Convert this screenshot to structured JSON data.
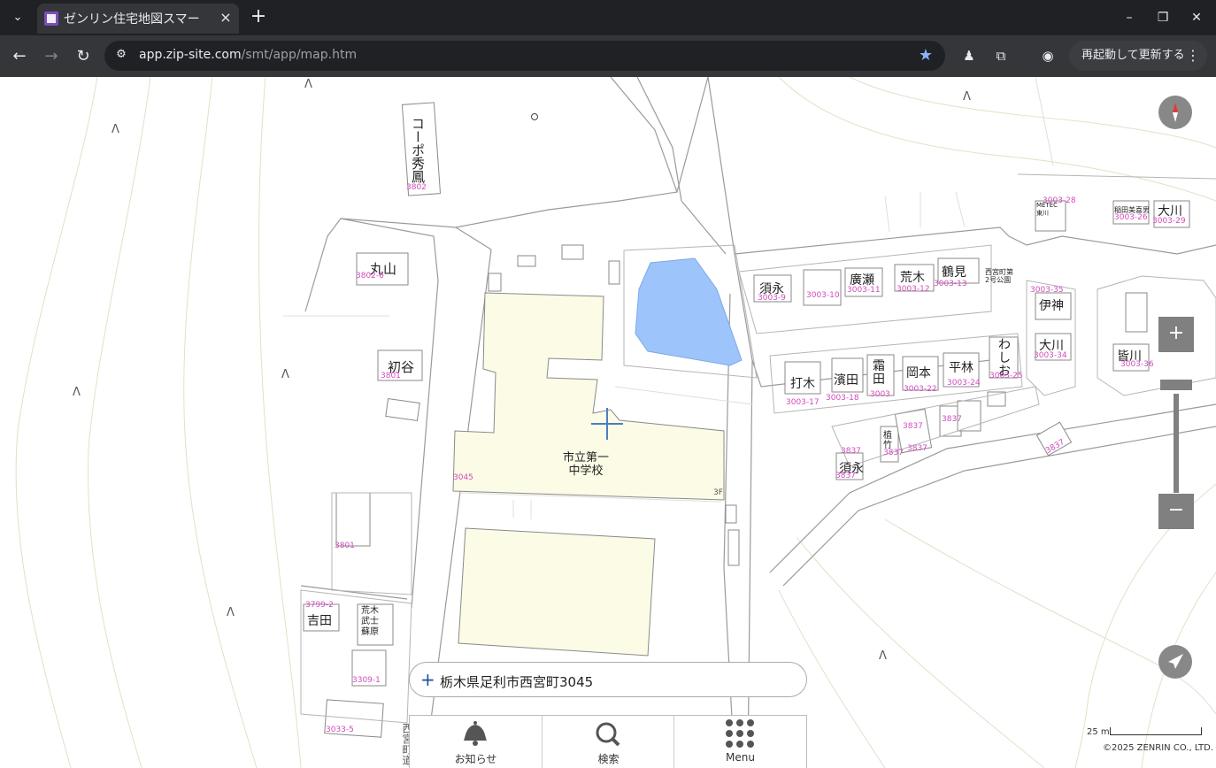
{
  "browser": {
    "tab_title": "ゼンリン住宅地図スマー",
    "url_host": "app.zip-site.com",
    "url_path": "/smt/app/map.htm",
    "restart_label": "再起動して更新する"
  },
  "map": {
    "labels": {
      "corpo": "コーポ秀鳳",
      "maruyama": "丸山",
      "hatsuya": "初谷",
      "yoshida": "吉田",
      "araki": "荒木\n武士\n蘇原",
      "school": "市立第一\n中学校",
      "sue1": "須永",
      "hirose": "廣瀬",
      "araki2": "荒木",
      "tsurumi": "鶴見",
      "utsugi": "打木",
      "hamada": "濱田",
      "shimoda": "霜田",
      "okamoto": "岡本",
      "hirabayashi": "平林",
      "washio": "わしお",
      "ijin": "伊神",
      "okawa1": "大川",
      "okawa2": "大川",
      "minagawa": "皆川",
      "park": "西宮町第\n2号公園",
      "sue2": "須永",
      "uekura": "植竹",
      "mehitec": "METEC\n東川",
      "kubota": "稲田美喜男"
    },
    "numbers": {
      "n3802": "3802",
      "n3802_6": "3802-6",
      "n3801a": "3801",
      "n3801b": "3801",
      "n3799_2": "3799-2",
      "n3309_1": "3309-1",
      "n3033_5": "3033-5",
      "n3045": "3045",
      "n3f": "3F",
      "n3003_9": "3003-9",
      "n3003_10": "3003-10",
      "n3003_11": "3003-11",
      "n3003_12": "3003-12",
      "n3003_13": "3003-13",
      "n3003_17": "3003-17",
      "n3003_18": "3003-18",
      "n3003": "3003",
      "n3003_22": "3003-22",
      "n3003_24": "3003-24",
      "n3003_25": "3003-25",
      "n3003_34": "3003-34",
      "n3003_35": "3003-35",
      "n3003_28": "3003-28",
      "n3003_26": "3003-26",
      "n3003_29": "3003-29",
      "n3003_36": "3003-36",
      "n3837a": "3837",
      "n3837b": "3837",
      "n3837c": "3837",
      "n3837d": "3837",
      "n3837e": "3837",
      "n3837f": "3837",
      "n3837g": "3837"
    },
    "road_label": "西宮町道",
    "address": "栃木県足利市西宮町3045",
    "scale": "25 m",
    "copyright": "©2025 ZENRIN CO., LTD.",
    "zoom_in": "+",
    "zoom_out": "−"
  },
  "menu": {
    "notice": "お知らせ",
    "search": "検索",
    "menu": "Menu"
  },
  "colors": {
    "building_fill": "#fbfbe6",
    "pond": "#9ec5fb",
    "lot_number": "#d24bbd"
  }
}
